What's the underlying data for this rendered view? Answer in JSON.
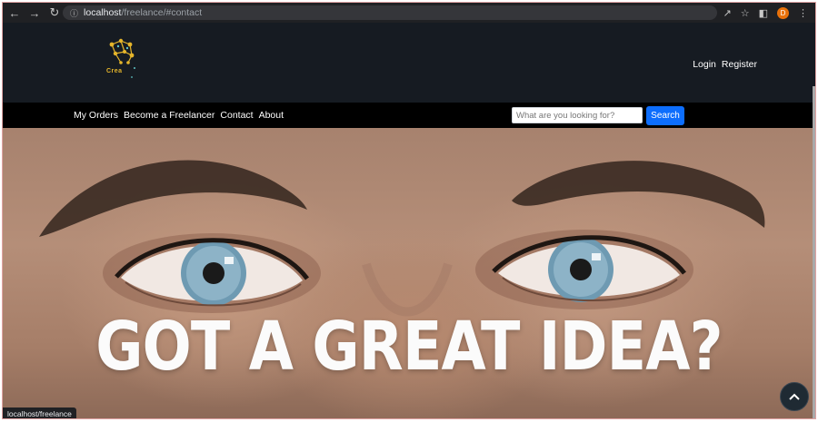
{
  "browser": {
    "url_host": "localhost",
    "url_path": "/freelance/#contact",
    "profile_initial": "D",
    "status_url": "localhost/freelance"
  },
  "logo": {
    "text": "Crea"
  },
  "header": {
    "login_label": "Login",
    "register_label": "Register"
  },
  "navbar": {
    "links": [
      "My Orders",
      "Become a Freelancer",
      "Contact",
      "About"
    ],
    "search_placeholder": "What are you looking for?",
    "search_button_label": "Search"
  },
  "hero": {
    "title": "GOT A GREAT IDEA?"
  },
  "colors": {
    "header_bg": "#161b22",
    "navbar_bg": "#000000",
    "search_button": "#0d6efd",
    "logo_accent": "#e5b52b"
  },
  "icons": [
    "back-arrow-icon",
    "forward-arrow-icon",
    "reload-icon",
    "info-icon",
    "share-icon",
    "star-icon",
    "sidebar-icon",
    "menu-dots-icon",
    "chevron-up-icon"
  ]
}
